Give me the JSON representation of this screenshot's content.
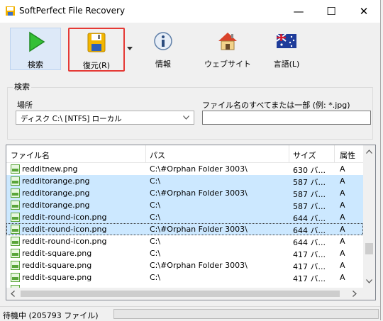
{
  "window": {
    "title": "SoftPerfect File Recovery",
    "minimize": "—",
    "maximize": "☐",
    "close": "✕"
  },
  "toolbar": {
    "search_label": "検索",
    "restore_label": "復元(R)",
    "info_label": "情報",
    "website_label": "ウェブサイト",
    "language_label": "言語(L)"
  },
  "search_group": {
    "title": "検索",
    "location_label": "場所",
    "location_value": "ディスク C:\\ [NTFS] ローカル",
    "filename_label": "ファイル名のすべてまたは一部 (例: *.jpg)",
    "filename_value": ""
  },
  "file_list": {
    "columns": [
      "ファイル名",
      "パス",
      "サイズ",
      "属性"
    ],
    "rows": [
      {
        "name": "redditnew.png",
        "path": "C:\\#Orphan Folder 3003\\",
        "size": "630 バ...",
        "attr": "A"
      },
      {
        "name": "redditorange.png",
        "path": "C:\\",
        "size": "587 バ...",
        "attr": "A"
      },
      {
        "name": "redditorange.png",
        "path": "C:\\#Orphan Folder 3003\\",
        "size": "587 バ...",
        "attr": "A"
      },
      {
        "name": "redditorange.png",
        "path": "C:\\",
        "size": "587 バ...",
        "attr": "A"
      },
      {
        "name": "reddit-round-icon.png",
        "path": "C:\\",
        "size": "644 バ...",
        "attr": "A"
      },
      {
        "name": "reddit-round-icon.png",
        "path": "C:\\#Orphan Folder 3003\\",
        "size": "644 バ...",
        "attr": "A"
      },
      {
        "name": "reddit-round-icon.png",
        "path": "C:\\",
        "size": "644 バ...",
        "attr": "A"
      },
      {
        "name": "reddit-square.png",
        "path": "C:\\",
        "size": "417 バ...",
        "attr": "A"
      },
      {
        "name": "reddit-square.png",
        "path": "C:\\#Orphan Folder 3003\\",
        "size": "417 バ...",
        "attr": "A"
      },
      {
        "name": "reddit-square.png",
        "path": "C:\\",
        "size": "417 バ...",
        "attr": "A"
      }
    ],
    "selected_rows": [
      1,
      2,
      3,
      4,
      5
    ],
    "focused_row": 5
  },
  "status_bar": {
    "text": "待機中 (205793 ファイル)"
  },
  "colors": {
    "selection": "#cce8ff",
    "highlight_border": "#e53935"
  }
}
